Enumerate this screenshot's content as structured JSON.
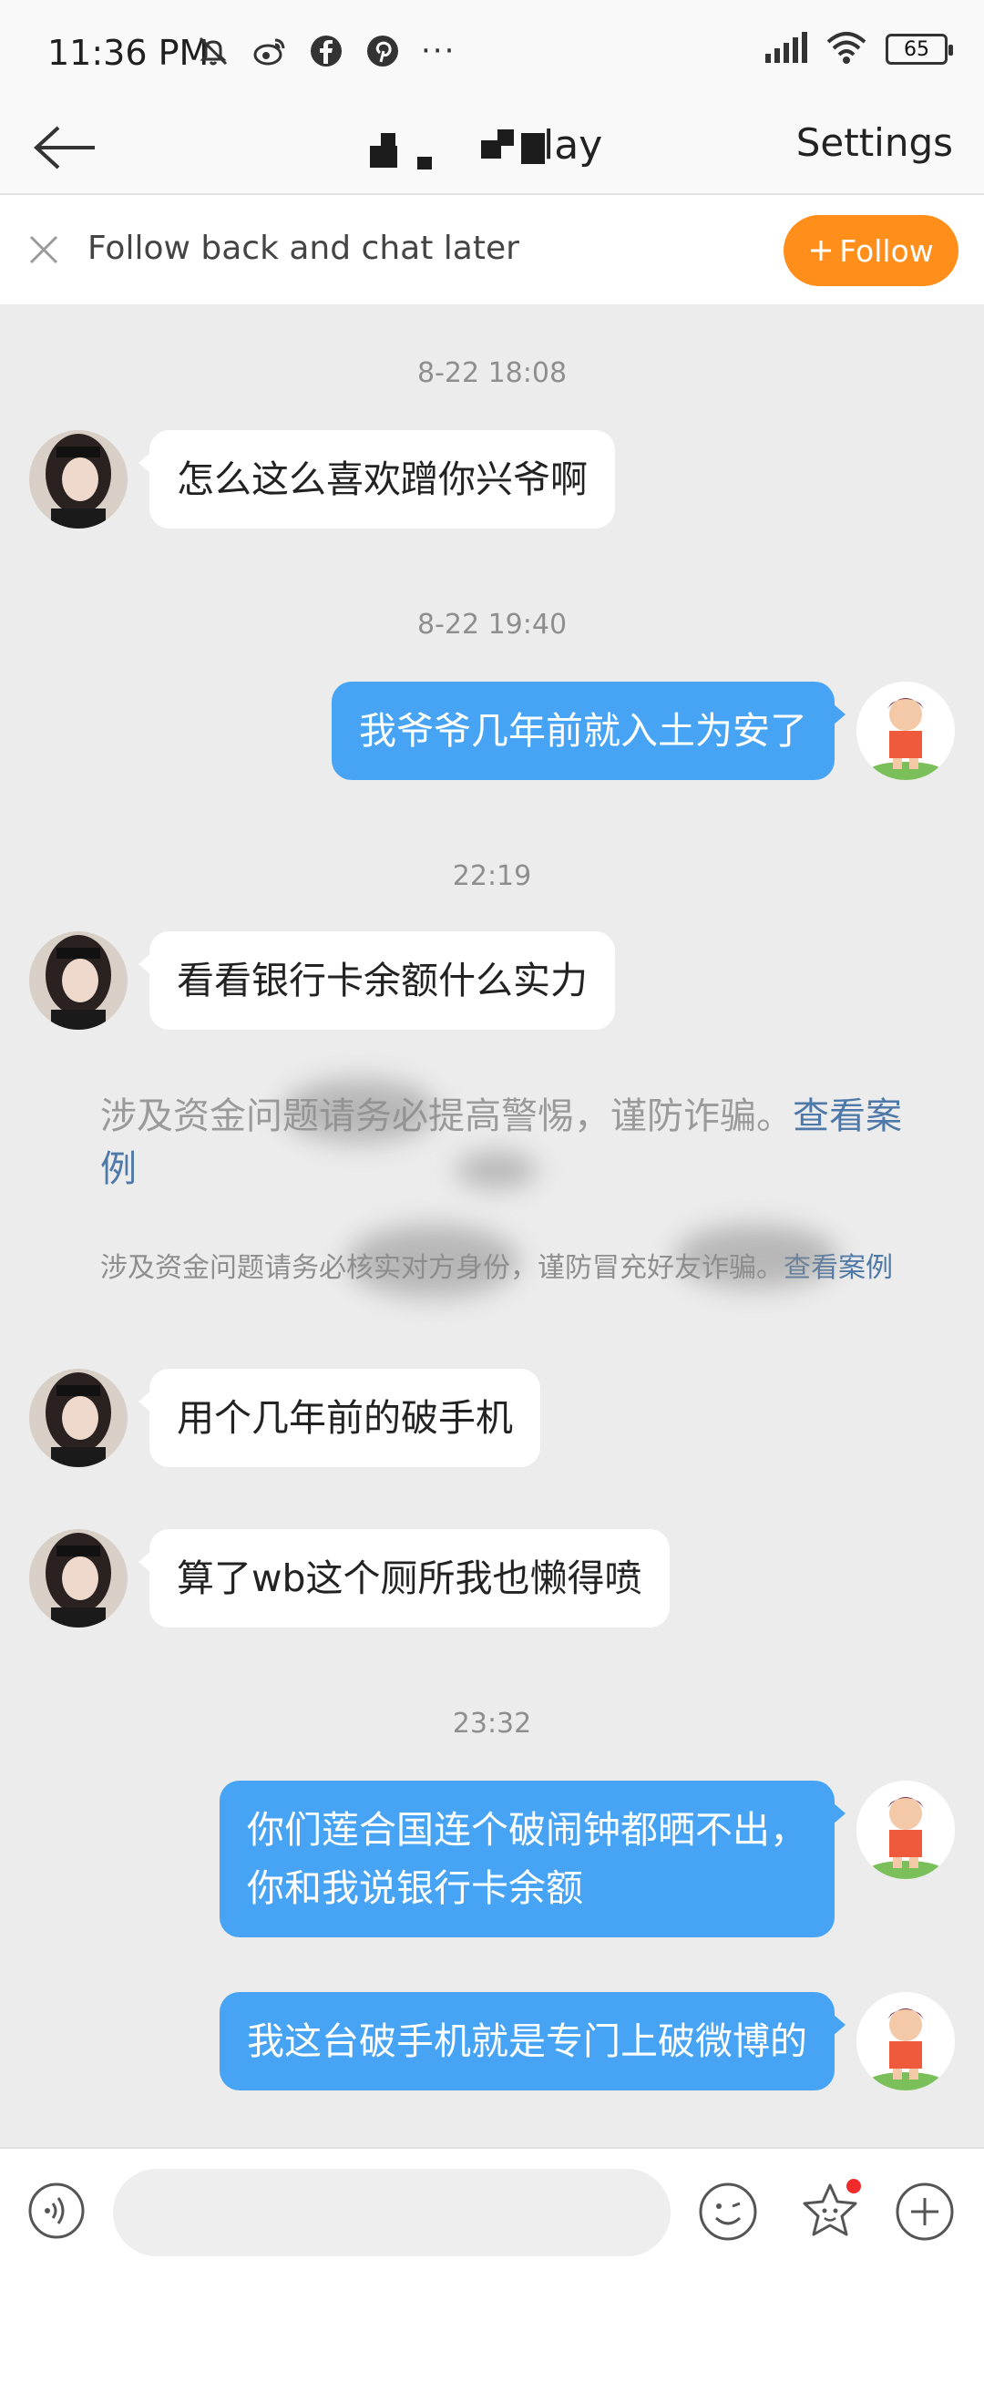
{
  "status_bar": {
    "time": "11:36 PM",
    "icons": [
      "mute-notification-icon",
      "weibo-icon",
      "facebook-icon",
      "pinterest-icon",
      "more-dots-icon"
    ],
    "more": "···",
    "battery": "65"
  },
  "header": {
    "title": "lay",
    "settings_label": "Settings"
  },
  "follow_bar": {
    "text": "Follow back and chat later",
    "button_label": "Follow",
    "button_color": "#ff8f1a"
  },
  "messages": [
    {
      "type": "timestamp",
      "text": "8-22 18:08"
    },
    {
      "type": "incoming",
      "text": "怎么这么喜欢蹭你兴爷啊"
    },
    {
      "type": "timestamp",
      "text": "8-22 19:40"
    },
    {
      "type": "outgoing",
      "text": "我爷爷几年前就入土为安了"
    },
    {
      "type": "timestamp",
      "text": "22:19"
    },
    {
      "type": "incoming",
      "text": "看看银行卡余额什么实力"
    },
    {
      "type": "system",
      "text": "涉及资金问题请务必提高警惕，谨防诈骗。",
      "link": "查看案例"
    },
    {
      "type": "system",
      "text": "涉及资金问题请务必核实对方身份，谨防冒充好友诈骗。",
      "link": "查看案例"
    },
    {
      "type": "incoming",
      "text": "用个几年前的破手机"
    },
    {
      "type": "incoming",
      "text": "算了wb这个厕所我也懒得喷"
    },
    {
      "type": "timestamp",
      "text": "23:32"
    },
    {
      "type": "outgoing",
      "line1": "你们莲合国连个破闹钟都晒不出，",
      "line2": "你和我说银行卡余额"
    },
    {
      "type": "outgoing",
      "text": "我这台破手机就是专门上破微博的"
    }
  ],
  "colors": {
    "chat_background": "#ececec",
    "outgoing_bubble": "#47a4f5",
    "incoming_bubble": "#ffffff",
    "link": "#4d78a8"
  },
  "input_bar": {
    "placeholder": "",
    "icons": [
      "voice-icon",
      "emoji-icon",
      "sticker-icon",
      "plus-icon"
    ]
  }
}
